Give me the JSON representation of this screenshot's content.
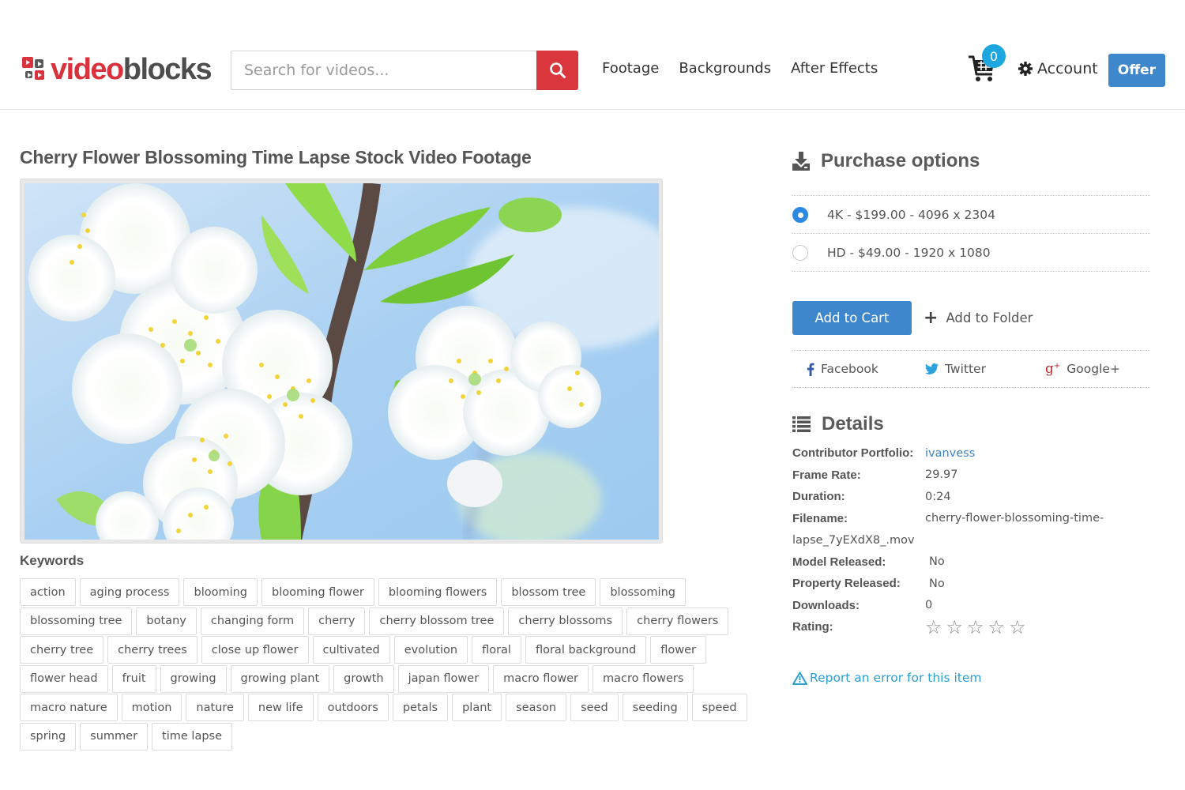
{
  "brand": {
    "part1": "video",
    "part2": "blocks",
    "red": "#d9323d",
    "dark": "#4d4d4d"
  },
  "search": {
    "placeholder": "Search for videos...",
    "value": ""
  },
  "nav": {
    "items": [
      {
        "label": "Footage"
      },
      {
        "label": "Backgrounds"
      },
      {
        "label": "After Effects"
      }
    ]
  },
  "cart": {
    "count": "0"
  },
  "account": {
    "label": "Account"
  },
  "offer": {
    "label": "Offer"
  },
  "page": {
    "title": "Cherry Flower Blossoming Time Lapse Stock Video Footage"
  },
  "keywords": {
    "title": "Keywords",
    "items": [
      "action",
      "aging process",
      "blooming",
      "blooming flower",
      "blooming flowers",
      "blossom tree",
      "blossoming",
      "blossoming tree",
      "botany",
      "changing form",
      "cherry",
      "cherry blossom tree",
      "cherry blossoms",
      "cherry flowers",
      "cherry tree",
      "cherry trees",
      "close up flower",
      "cultivated",
      "evolution",
      "floral",
      "floral background",
      "flower",
      "flower head",
      "fruit",
      "growing",
      "growing plant",
      "growth",
      "japan flower",
      "macro flower",
      "macro flowers",
      "macro nature",
      "motion",
      "nature",
      "new life",
      "outdoors",
      "petals",
      "plant",
      "season",
      "seed",
      "seeding",
      "speed",
      "spring",
      "summer",
      "time lapse"
    ]
  },
  "purchase": {
    "title": "Purchase options",
    "options": [
      {
        "label": "4K - $199.00 - 4096 x 2304",
        "selected": true
      },
      {
        "label": "HD - $49.00 - 1920 x 1080",
        "selected": false
      }
    ],
    "add_to_cart": "Add to Cart",
    "add_to_folder": "Add to Folder"
  },
  "share": {
    "facebook": "Facebook",
    "twitter": "Twitter",
    "google": "Google+"
  },
  "details": {
    "title": "Details",
    "contributor_label": "Contributor Portfolio:",
    "contributor_value": "ivanvess",
    "frame_rate_label": "Frame Rate:",
    "frame_rate_value": "29.97",
    "duration_label": "Duration:",
    "duration_value": "0:24",
    "filename_label": "Filename:",
    "filename_value_1": "cherry-flower-blossoming-time-",
    "filename_value_2": "lapse_7yEXdX8_.mov",
    "model_label": "Model Released:",
    "model_value": "No",
    "property_label": "Property Released:",
    "property_value": "No",
    "downloads_label": "Downloads:",
    "downloads_value": "0",
    "rating_label": "Rating:",
    "rating_value": 0,
    "rating_max": 5
  },
  "report": {
    "label": "Report an error for this item"
  },
  "colors": {
    "accent_blue": "#3f87cc",
    "search_red": "#d9363e",
    "badge_blue": "#1ea6e0",
    "link_teal": "#2aa0d2"
  }
}
